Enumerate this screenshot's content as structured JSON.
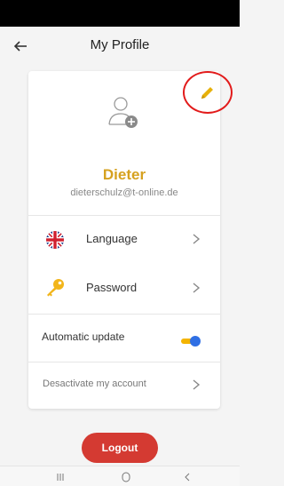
{
  "header": {
    "title": "My Profile",
    "back_icon": "arrow-left-icon"
  },
  "profile": {
    "avatar_icon": "add-user-icon",
    "edit_icon": "pencil-icon",
    "name": "Dieter",
    "email": "dieterschulz@t-online.de"
  },
  "settings": {
    "language_label": "Language",
    "language_icon": "uk-flag-icon",
    "password_label": "Password",
    "password_icon": "key-icon",
    "auto_update_label": "Automatic update",
    "auto_update_on": true,
    "deactivate_label": "Desactivate my account"
  },
  "actions": {
    "logout_label": "Logout"
  },
  "colors": {
    "accent_yellow": "#d6a11f",
    "logout_red": "#d43a32",
    "toggle_blue": "#2f6fe4",
    "highlight_circle": "#e21b1b"
  },
  "nav": {
    "recents_icon": "recent-apps-icon",
    "home_icon": "home-icon",
    "back_icon": "back-icon"
  }
}
